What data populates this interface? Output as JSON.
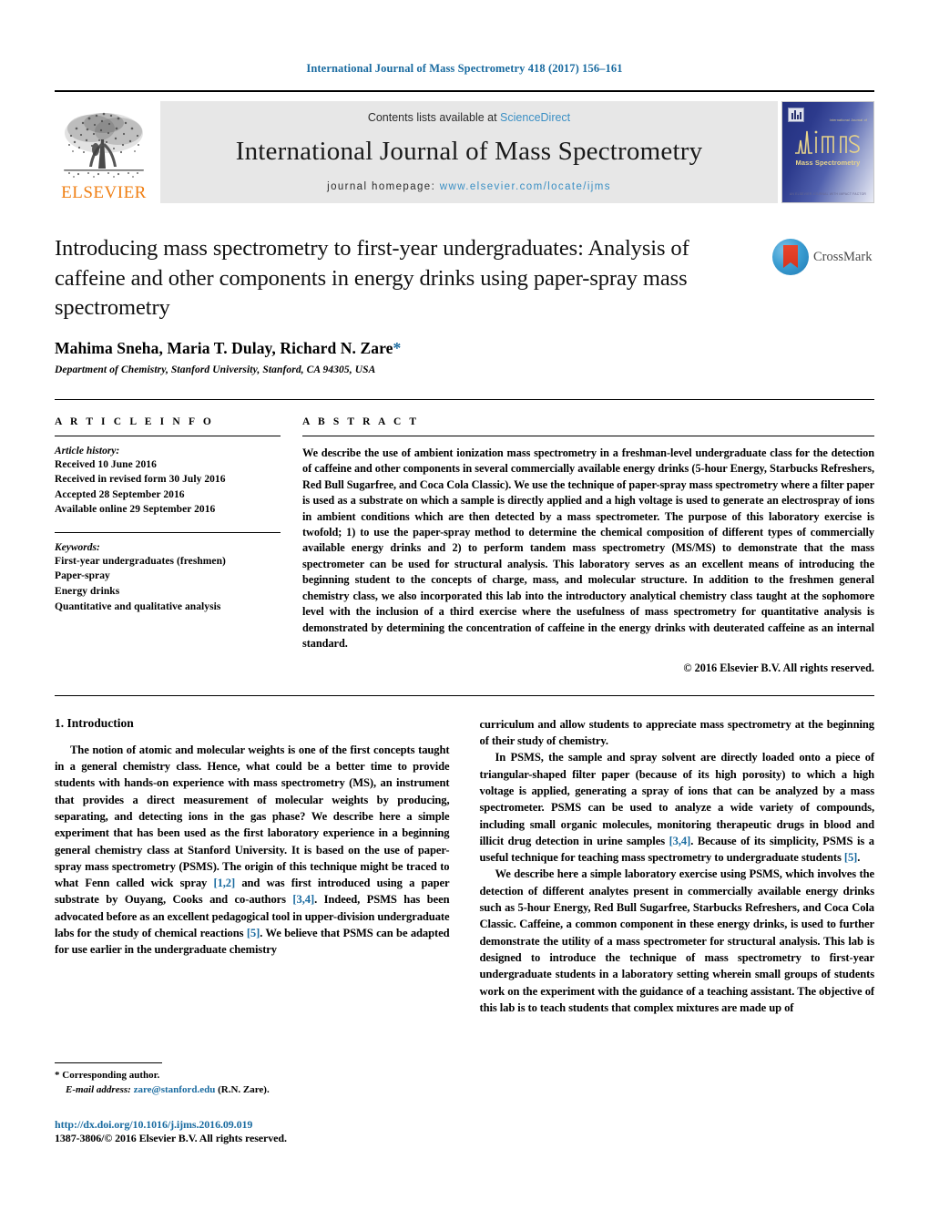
{
  "running_head": "International Journal of Mass Spectrometry 418 (2017) 156–161",
  "masthead": {
    "publisher_name": "ELSEVIER",
    "contents_prefix": "Contents lists available at ",
    "contents_link": "ScienceDirect",
    "journal_name": "International Journal of Mass Spectrometry",
    "homepage_prefix": "journal homepage:",
    "homepage_url": "www.elsevier.com/locate/ijms",
    "cover": {
      "logo_text": "IJMS",
      "caption": "Mass Spectrometry",
      "top_micro_text": "International Journal of",
      "bottom_micro_text": "AN ELSEVIER JOURNAL WITH IMPACT FACTOR",
      "accent_color": "#23307e",
      "caption_color": "#e8d48a"
    }
  },
  "article": {
    "title": "Introducing mass spectrometry to first-year undergraduates: Analysis of caffeine and other components in energy drinks using paper-spray mass spectrometry",
    "crossmark_label": "CrossMark",
    "authors": "Mahima Sneha, Maria T. Dulay, Richard N. Zare",
    "corresponding_marker": "*",
    "affiliation": "Department of Chemistry, Stanford University, Stanford, CA 94305, USA"
  },
  "article_info": {
    "heading": "A R T I C L E   I N F O",
    "history_label": "Article history:",
    "history": [
      "Received 10 June 2016",
      "Received in revised form 30 July 2016",
      "Accepted 28 September 2016",
      "Available online 29 September 2016"
    ],
    "keywords_label": "Keywords:",
    "keywords": [
      "First-year undergraduates (freshmen)",
      "Paper-spray",
      "Energy drinks",
      "Quantitative and qualitative analysis"
    ]
  },
  "abstract": {
    "heading": "A B S T R A C T",
    "text": "We describe the use of ambient ionization mass spectrometry in a freshman-level undergraduate class for the detection of caffeine and other components in several commercially available energy drinks (5-hour Energy, Starbucks Refreshers, Red Bull Sugarfree, and Coca Cola Classic). We use the technique of paper-spray mass spectrometry where a filter paper is used as a substrate on which a sample is directly applied and a high voltage is used to generate an electrospray of ions in ambient conditions which are then detected by a mass spectrometer. The purpose of this laboratory exercise is twofold; 1) to use the paper-spray method to determine the chemical composition of different types of commercially available energy drinks and 2) to perform tandem mass spectrometry (MS/MS) to demonstrate that the mass spectrometer can be used for structural analysis. This laboratory serves as an excellent means of introducing the beginning student to the concepts of charge, mass, and molecular structure. In addition to the freshmen general chemistry class, we also incorporated this lab into the introductory analytical chemistry class taught at the sophomore level with the inclusion of a third exercise where the usefulness of mass spectrometry for quantitative analysis is demonstrated by determining the concentration of caffeine in the energy drinks with deuterated caffeine as an internal standard.",
    "copyright": "© 2016 Elsevier B.V. All rights reserved."
  },
  "body": {
    "section_number_title": "1.  Introduction",
    "left_paragraphs": [
      "The notion of atomic and molecular weights is one of the first concepts taught in a general chemistry class. Hence, what could be a better time to provide students with hands-on experience with mass spectrometry (MS), an instrument that provides a direct measurement of molecular weights by producing, separating, and detecting ions in the gas phase? We describe here a simple experiment that has been used as the first laboratory experience in a beginning general chemistry class at Stanford University. It is based on the use of paper-spray mass spectrometry (PSMS). The origin of this technique might be traced to what Fenn called wick spray [1,2] and was first introduced using a paper substrate by Ouyang, Cooks and co-authors [3,4]. Indeed, PSMS has been advocated before as an excellent pedagogical tool in upper-division undergraduate labs for the study of chemical reactions [5]. We believe that PSMS can be adapted for use earlier in the undergraduate chemistry"
    ],
    "right_paragraphs": [
      "curriculum and allow students to appreciate mass spectrometry at the beginning of their study of chemistry.",
      "In PSMS, the sample and spray solvent are directly loaded onto a piece of triangular-shaped filter paper (because of its high porosity) to which a high voltage is applied, generating a spray of ions that can be analyzed by a mass spectrometer. PSMS can be used to analyze a wide variety of compounds, including small organic molecules, monitoring therapeutic drugs in blood and illicit drug detection in urine samples [3,4]. Because of its simplicity, PSMS is a useful technique for teaching mass spectrometry to undergraduate students [5].",
      "We describe here a simple laboratory exercise using PSMS, which involves the detection of different analytes present in commercially available energy drinks such as 5-hour Energy, Red Bull Sugarfree, Starbucks Refreshers, and Coca Cola Classic. Caffeine, a common component in these energy drinks, is used to further demonstrate the utility of a mass spectrometer for structural analysis. This lab is designed to introduce the technique of mass spectrometry to first-year undergraduate students in a laboratory setting wherein small groups of students work on the experiment with the guidance of a teaching assistant. The objective of this lab is to teach students that complex mixtures are made up of"
    ]
  },
  "footnotes": {
    "corresponding_author": "*  Corresponding author.",
    "email_label": "E-mail address:",
    "email": "zare@stanford.edu",
    "email_suffix": " (R.N. Zare).",
    "doi": "http://dx.doi.org/10.1016/j.ijms.2016.09.019",
    "issn": "1387-3806/© 2016 Elsevier B.V. All rights reserved."
  },
  "colors": {
    "link_blue": "#1a6ba0",
    "sciencedirect_blue": "#3a8fc4",
    "elsevier_orange": "#f07f13",
    "cover_blue": "#23307e"
  }
}
